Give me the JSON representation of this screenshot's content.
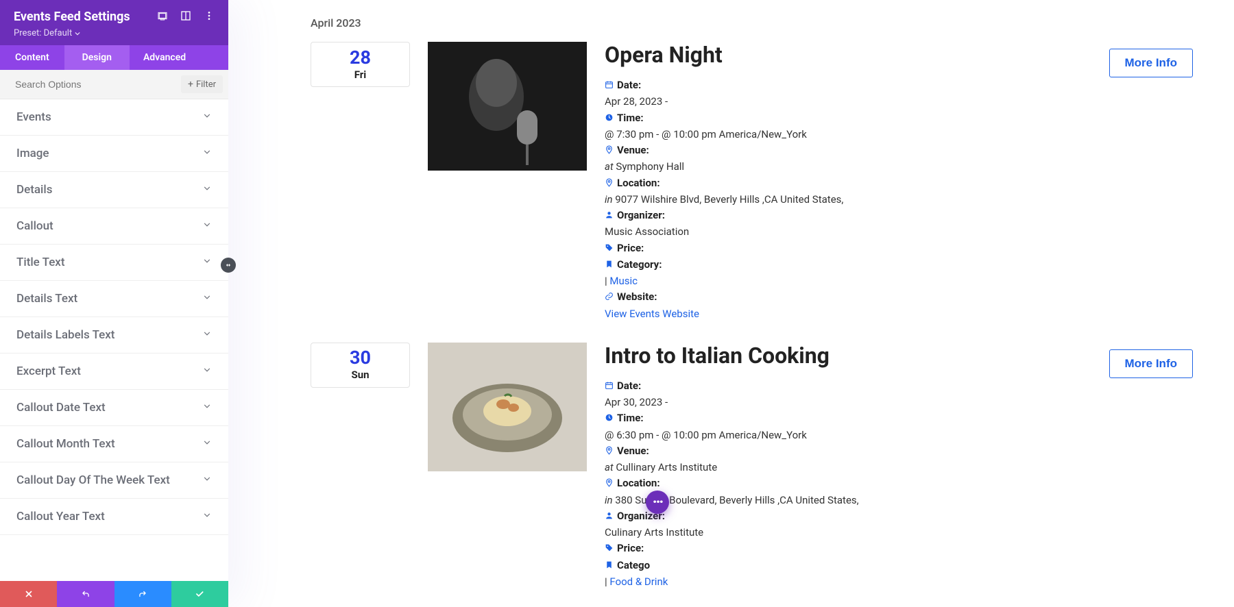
{
  "sidebar": {
    "title": "Events Feed Settings",
    "preset": "Preset: Default",
    "tabs": {
      "content": "Content",
      "design": "Design",
      "advanced": "Advanced"
    },
    "search_placeholder": "Search Options",
    "filter_label": "Filter",
    "sections": [
      {
        "label": "Events"
      },
      {
        "label": "Image"
      },
      {
        "label": "Details"
      },
      {
        "label": "Callout"
      },
      {
        "label": "Title Text"
      },
      {
        "label": "Details Text"
      },
      {
        "label": "Details Labels Text"
      },
      {
        "label": "Excerpt Text"
      },
      {
        "label": "Callout Date Text"
      },
      {
        "label": "Callout Month Text"
      },
      {
        "label": "Callout Day Of The Week Text"
      },
      {
        "label": "Callout Year Text"
      }
    ]
  },
  "main": {
    "month": "April 2023",
    "more_info": "More Info",
    "labels": {
      "date": "Date:",
      "time": "Time:",
      "venue": "Venue:",
      "location": "Location:",
      "organizer": "Organizer:",
      "price": "Price:",
      "category": "Category:",
      "website": "Website:",
      "at": "at",
      "in": "in",
      "website_link": "View Events Website"
    },
    "events": [
      {
        "day": "28",
        "dow": "Fri",
        "title": "Opera Night",
        "date": "Apr 28, 2023 -",
        "time": "@ 7:30 pm - @ 10:00 pm America/New_York",
        "venue": "Symphony Hall",
        "location": "9077 Wilshire Blvd, Beverly Hills ,CA United States,",
        "organizer": "Music Association",
        "category": "Music",
        "img": "opera"
      },
      {
        "day": "30",
        "dow": "Sun",
        "title": "Intro to Italian Cooking",
        "date": "Apr 30, 2023 -",
        "time": "@ 6:30 pm - @ 10:00 pm America/New_York",
        "venue": "Cullinary Arts Institute",
        "location": "380 Sunset Boulevard, Beverly Hills ,CA United States,",
        "organizer": "Culinary Arts Institute",
        "category": "Food & Drink",
        "img": "pasta"
      }
    ]
  },
  "fab": "···"
}
